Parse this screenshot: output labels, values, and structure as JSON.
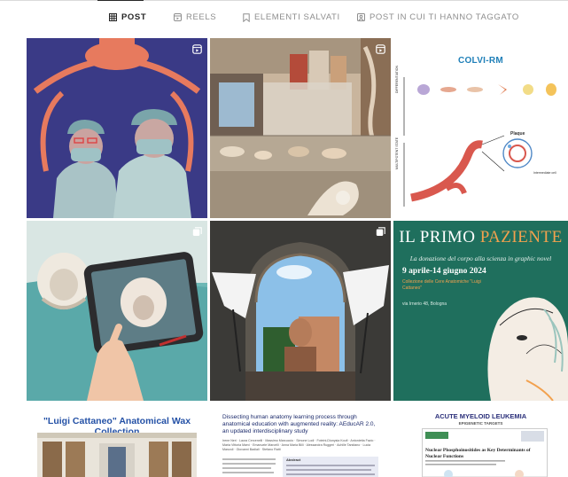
{
  "tabs": [
    {
      "label": "POST",
      "icon": "grid-icon",
      "active": true
    },
    {
      "label": "REELS",
      "icon": "reels-icon",
      "active": false
    },
    {
      "label": "ELEMENTI SALVATI",
      "icon": "bookmark-icon",
      "active": false
    },
    {
      "label": "POST IN CUI TI HANNO TAGGATO",
      "icon": "tagged-user-icon",
      "active": false
    }
  ],
  "posts": {
    "colvi": {
      "title": "COLVI-RM",
      "side_labels": [
        "DIFFERENTIATION",
        "MULTIPOTENT STATE"
      ],
      "cell_labels": [
        "Monocyte",
        "Vascular smooth muscle cell",
        "Fibroblast",
        "Myofibroblast",
        "Adipocyte",
        "Osteoblast"
      ],
      "plaque_label": "Plaque",
      "shoulder_label": "Intermediate cell"
    },
    "poster": {
      "title_main": "IL PRIMO",
      "title_accent": "PAZIENTE",
      "subtitle": "La donazione del corpo alla scienza in graphic novel",
      "dates": "9 aprile-14 giugno 2024",
      "place": "Collezione delle Cere Anatomiche \"Luigi Cattaneo\"",
      "address": "via Irnerio 48, Bologna"
    },
    "wax": {
      "title": "\"Luigi Cattaneo\" Anatomical Wax Collection"
    },
    "paper": {
      "title": "Dissecting human anatomy learning process through anatomical education with augmented reality: AEducAR 2.0, an updated interdisciplinary study",
      "authors": "Irene Neri · Laura Cercenelli · Massimo Marcuccio · Simone Lodi · Foteini-Dionysia Koufi · Antonietta Fazio · Maria Vittoria Marvi · Emanuele Marcelli · Anna Maria Billi · Alessandra Ruggeri · Achille Tarsitano · Lucia Manzoli · Giovanni Badiali · Stefano Ratti",
      "abstract_label": "Abstract"
    },
    "aml": {
      "title": "ACUTE MYELOID LEUKEMIA",
      "subtitle": "EPIGENETIC TARGETS",
      "headline": "Nuclear Phosphoinositides as Key Determinants of Nuclear Functions"
    }
  },
  "colors": {
    "tab_active": "#262626",
    "tab_inactive": "#8e8e8e",
    "poster_bg": "#1f6f5d",
    "poster_accent": "#f2a14e",
    "colvi_title": "#1e7fb8",
    "wax_title": "#2451a6"
  }
}
